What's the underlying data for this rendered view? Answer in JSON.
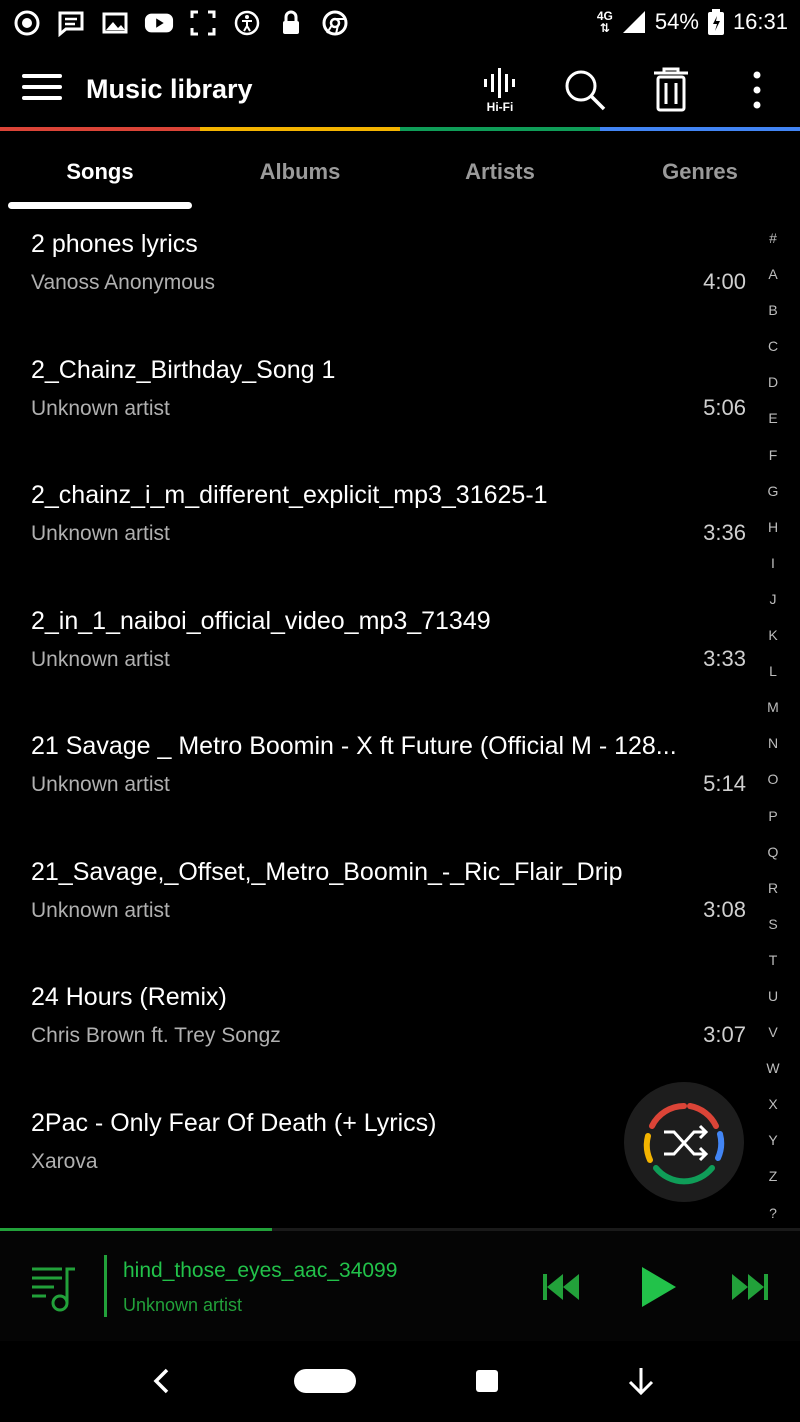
{
  "status_bar": {
    "network": "4G",
    "battery": "54%",
    "time": "16:31",
    "icons": [
      "whatsapp-icon",
      "message-icon",
      "gallery-icon",
      "youtube-icon",
      "screenshot-icon",
      "accessibility-icon",
      "lock-icon",
      "chrome-icon"
    ]
  },
  "app_bar": {
    "title": "Music library",
    "hifi_label": "Hi-Fi",
    "actions": [
      "equalizer-icon",
      "search-icon",
      "delete-icon",
      "more-icon"
    ]
  },
  "tabs": [
    {
      "label": "Songs",
      "active": true
    },
    {
      "label": "Albums",
      "active": false
    },
    {
      "label": "Artists",
      "active": false
    },
    {
      "label": "Genres",
      "active": false
    }
  ],
  "songs": [
    {
      "title": "2 phones lyrics",
      "artist": "Vanoss Anonymous",
      "duration": "4:00"
    },
    {
      "title": "2_Chainz_Birthday_Song 1",
      "artist": "Unknown artist",
      "duration": "5:06"
    },
    {
      "title": "2_chainz_i_m_different_explicit_mp3_31625-1",
      "artist": "Unknown artist",
      "duration": "3:36"
    },
    {
      "title": "2_in_1_naiboi_official_video_mp3_71349",
      "artist": "Unknown artist",
      "duration": "3:33"
    },
    {
      "title": "21 Savage _ Metro Boomin - X ft Future (Official M - 128...",
      "artist": "Unknown artist",
      "duration": "5:14"
    },
    {
      "title": "21_Savage,_Offset,_Metro_Boomin_-_Ric_Flair_Drip",
      "artist": "Unknown artist",
      "duration": "3:08"
    },
    {
      "title": "24 Hours (Remix)",
      "artist": "Chris Brown ft. Trey Songz",
      "duration": "3:07"
    },
    {
      "title": "2Pac - Only Fear Of Death (+ Lyrics)",
      "artist": "Xarova",
      "duration": ""
    }
  ],
  "alphabet_index": [
    "#",
    "A",
    "B",
    "C",
    "D",
    "E",
    "F",
    "G",
    "H",
    "I",
    "J",
    "K",
    "L",
    "M",
    "N",
    "O",
    "P",
    "Q",
    "R",
    "S",
    "T",
    "U",
    "V",
    "W",
    "X",
    "Y",
    "Z",
    "?"
  ],
  "now_playing": {
    "title": "hind_those_eyes_aac_34099",
    "artist": "Unknown artist",
    "progress": 0.34
  },
  "colors": {
    "accent": "#22a13a",
    "rainbow": [
      "#db4437",
      "#f4b400",
      "#0f9d58",
      "#4285f4"
    ]
  }
}
